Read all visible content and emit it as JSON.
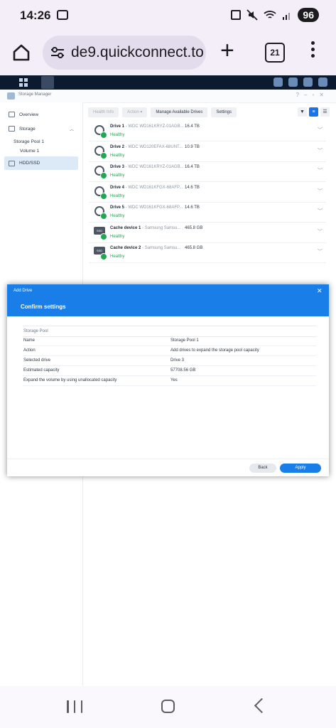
{
  "status_bar": {
    "time": "14:26",
    "battery": "96"
  },
  "browser": {
    "url": "de9.quickconnect.to",
    "tab_count": "21"
  },
  "window": {
    "title": "Storage Manager"
  },
  "sidebar": {
    "items": [
      {
        "label": "Overview"
      },
      {
        "label": "Storage"
      },
      {
        "label": "Storage Pool 1"
      },
      {
        "label": "Volume 1"
      },
      {
        "label": "HDD/SSD"
      }
    ]
  },
  "toolbar": {
    "health_info": "Health Info",
    "action": "Action ▾",
    "manage_drives": "Manage Available Drives",
    "settings": "Settings"
  },
  "drives": [
    {
      "name": "Drive 1",
      "model": " - WDC WD161KRYZ-01AGB...",
      "size": "16.4 TB",
      "status": "Healthy",
      "kind": "hdd"
    },
    {
      "name": "Drive 2",
      "model": " - WDC WD120EFAX-68UNT...",
      "size": "10.9 TB",
      "status": "Healthy",
      "kind": "hdd"
    },
    {
      "name": "Drive 3",
      "model": " - WDC WD161KRYZ-01AGB...",
      "size": "16.4 TB",
      "status": "Healthy",
      "kind": "hdd"
    },
    {
      "name": "Drive 4",
      "model": " - WDC WD161KFGX-68AFP...",
      "size": "14.6 TB",
      "status": "Healthy",
      "kind": "hdd"
    },
    {
      "name": "Drive 5",
      "model": " - WDC WD161KFGX-68AFP...",
      "size": "14.6 TB",
      "status": "Healthy",
      "kind": "hdd"
    },
    {
      "name": "Cache device 1",
      "model": " - Samsung Samsu...",
      "size": "465.8 GB",
      "status": "Healthy",
      "kind": "ssd"
    },
    {
      "name": "Cache device 2",
      "model": " - Samsung Samsu...",
      "size": "465.8 GB",
      "status": "Healthy",
      "kind": "ssd"
    }
  ],
  "ssd_label": "SSD",
  "dialog": {
    "header": "Add Drive",
    "title": "Confirm settings",
    "section": "Storage Pool",
    "rows": [
      {
        "key": "Name",
        "value": "Storage Pool 1"
      },
      {
        "key": "Action",
        "value": "Add drives to expand the storage pool capacity"
      },
      {
        "key": "Selected drive",
        "value": "Drive 3"
      },
      {
        "key": "Estimated capacity",
        "value": "57708.56 GB"
      },
      {
        "key": "Expand the volume by using unallocated capacity",
        "value": "Yes"
      }
    ],
    "back": "Back",
    "apply": "Apply"
  },
  "colors": {
    "accent": "#1a7ee8",
    "healthy": "#1ea84f",
    "dsm_bar": "#0b1a2e"
  }
}
